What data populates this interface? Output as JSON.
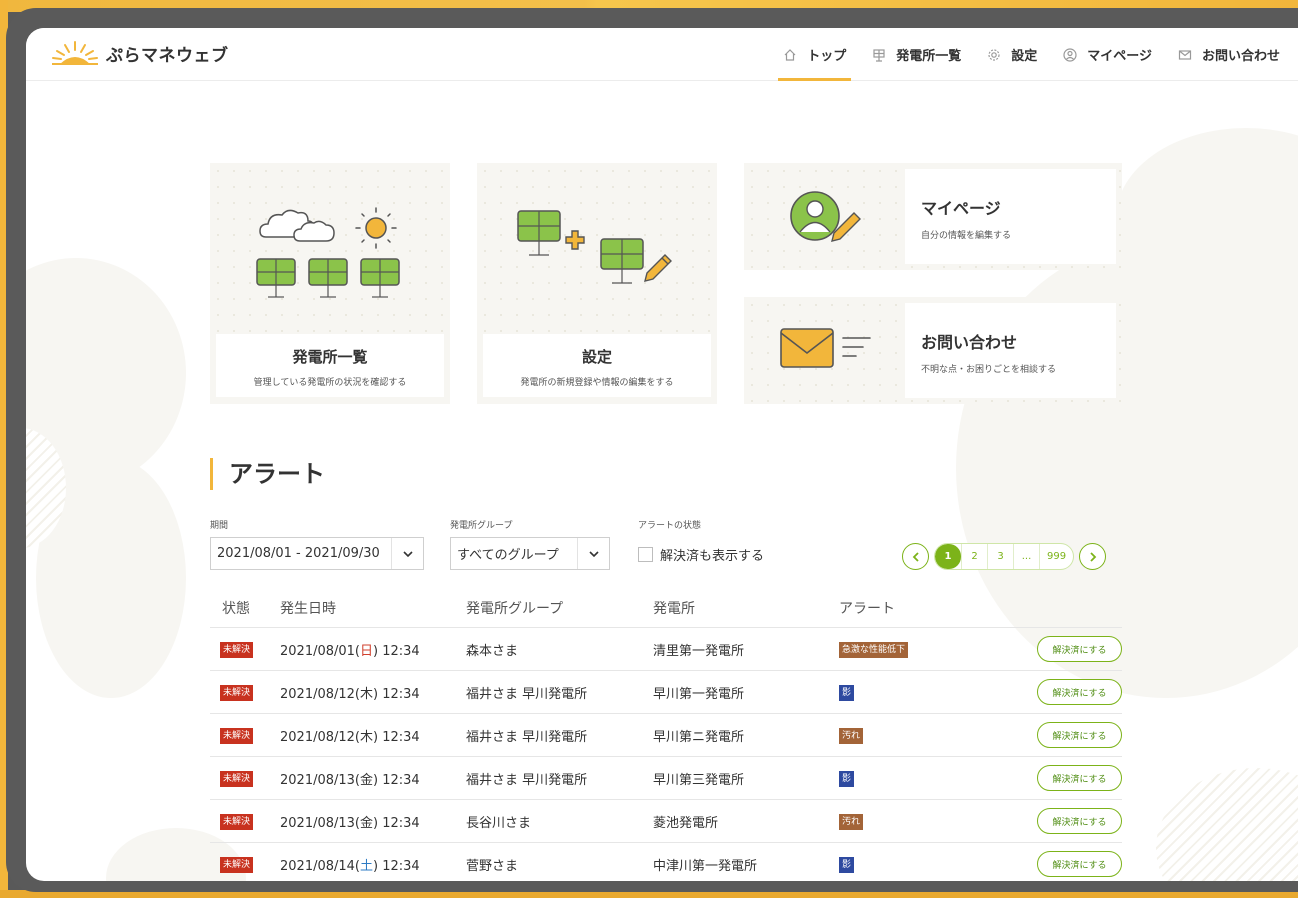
{
  "app": {
    "name": "ぷらマネウェブ"
  },
  "nav": [
    {
      "label": "トップ",
      "icon": "home-icon",
      "active": true
    },
    {
      "label": "発電所一覧",
      "icon": "solar-panel-icon",
      "active": false
    },
    {
      "label": "設定",
      "icon": "gear-icon",
      "active": false
    },
    {
      "label": "マイページ",
      "icon": "user-icon",
      "active": false
    },
    {
      "label": "お問い合わせ",
      "icon": "mail-icon",
      "active": false
    }
  ],
  "cards": {
    "plants": {
      "title": "発電所一覧",
      "subtitle": "管理している発電所の状況を確認する"
    },
    "settings": {
      "title": "設定",
      "subtitle": "発電所の新規登録や情報の編集をする"
    },
    "mypage": {
      "title": "マイページ",
      "subtitle": "自分の情報を編集する"
    },
    "contact": {
      "title": "お問い合わせ",
      "subtitle": "不明な点・お困りごとを相談する"
    }
  },
  "alerts": {
    "title": "アラート",
    "filters": {
      "period_label": "期間",
      "period_value": "2021/08/01 - 2021/09/30",
      "group_label": "発電所グループ",
      "group_value": "すべてのグループ",
      "status_label": "アラートの状態",
      "show_resolved_label": "解決済も表示する"
    },
    "pagination": {
      "pages": [
        "1",
        "2",
        "3",
        "...",
        "999"
      ],
      "current": "1"
    },
    "columns": [
      "状態",
      "発生日時",
      "発電所グループ",
      "発電所",
      "アラート"
    ],
    "rows": [
      {
        "status": "未解決",
        "date": "2021/08/01(",
        "dow": "日",
        "dow_type": "sun",
        "time": ") 12:34",
        "group": "森本さま",
        "plant": "清里第一発電所",
        "alert": "急激な性能低下",
        "alert_color": "brown",
        "action": "解決済にする"
      },
      {
        "status": "未解決",
        "date": "2021/08/12(",
        "dow": "木",
        "dow_type": "weekday",
        "time": ") 12:34",
        "group": "福井さま 早川発電所",
        "plant": "早川第一発電所",
        "alert": "影",
        "alert_color": "blue",
        "action": "解決済にする"
      },
      {
        "status": "未解決",
        "date": "2021/08/12(",
        "dow": "木",
        "dow_type": "weekday",
        "time": ") 12:34",
        "group": "福井さま 早川発電所",
        "plant": "早川第ニ発電所",
        "alert": "汚れ",
        "alert_color": "brown",
        "action": "解決済にする"
      },
      {
        "status": "未解決",
        "date": "2021/08/13(",
        "dow": "金",
        "dow_type": "weekday",
        "time": ") 12:34",
        "group": "福井さま 早川発電所",
        "plant": "早川第三発電所",
        "alert": "影",
        "alert_color": "blue",
        "action": "解決済にする"
      },
      {
        "status": "未解決",
        "date": "2021/08/13(",
        "dow": "金",
        "dow_type": "weekday",
        "time": ") 12:34",
        "group": "長谷川さま",
        "plant": "菱池発電所",
        "alert": "汚れ",
        "alert_color": "brown",
        "action": "解決済にする"
      },
      {
        "status": "未解決",
        "date": "2021/08/14(",
        "dow": "土",
        "dow_type": "sat",
        "time": ") 12:34",
        "group": "菅野さま",
        "plant": "中津川第一発電所",
        "alert": "影",
        "alert_color": "blue",
        "action": "解決済にする"
      }
    ]
  },
  "colors": {
    "accent": "#f2b63b",
    "green": "#7cb319",
    "danger": "#c8321f"
  }
}
